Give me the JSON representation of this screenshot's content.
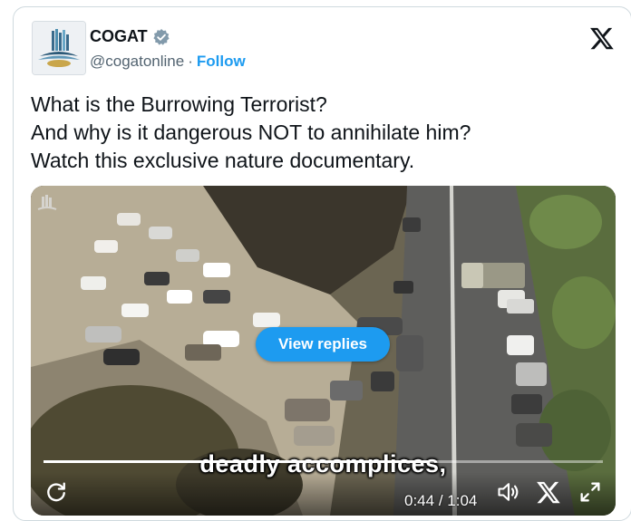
{
  "author": {
    "name": "COGAT",
    "handle": "@cogatonline",
    "separator": "·",
    "follow_label": "Follow",
    "verified": true
  },
  "tweet": {
    "lines": [
      "What is the Burrowing Terrorist?",
      "And why is it dangerous NOT to annihilate him?",
      "Watch this exclusive nature documentary."
    ]
  },
  "media": {
    "view_replies_label": "View replies",
    "subtitle": "deadly accomplices,",
    "current_time": "0:44",
    "time_separator": " / ",
    "duration": "1:04",
    "progress": 0.6875
  },
  "colors": {
    "accent": "#1d9bf0",
    "text": "#0f1419",
    "muted": "#536471",
    "border": "#cfd9de"
  },
  "icons": [
    "verified-badge-icon",
    "x-logo-icon",
    "replay-icon",
    "volume-icon",
    "close-icon",
    "fullscreen-icon"
  ]
}
